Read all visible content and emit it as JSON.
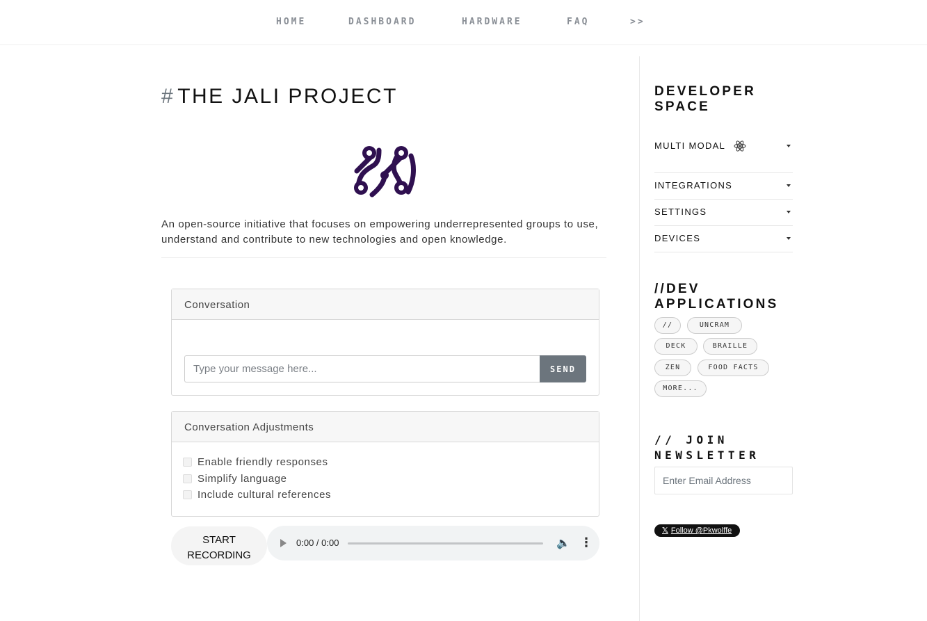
{
  "nav": {
    "items": [
      "HOME",
      "DASHBOARD",
      "HARDWARE",
      "FAQ",
      ">>"
    ]
  },
  "main": {
    "title_hash": "#",
    "title": "THE JALI PROJECT",
    "logo_icon": "circuit-logo-icon",
    "description": "An open-source initiative that focuses on empowering underrepresented groups to use, understand and contribute to new technologies and open knowledge.",
    "conversation": {
      "header": "Conversation",
      "input_placeholder": "Type your message here...",
      "input_value": "",
      "send_label": "SEND"
    },
    "adjustments": {
      "header": "Conversation Adjustments",
      "options": [
        {
          "label": "Enable friendly responses",
          "checked": false
        },
        {
          "label": "Simplify language",
          "checked": false
        },
        {
          "label": "Include cultural references",
          "checked": false
        }
      ]
    },
    "recorder": {
      "button_label_line1": "START",
      "button_label_line2": "RECORDING",
      "time": "0:00 / 0:00"
    }
  },
  "sidebar": {
    "developer_title": "DEVELOPER SPACE",
    "sections": [
      {
        "label": "MULTI MODAL",
        "icon": "react-atom-icon"
      },
      {
        "label": "INTEGRATIONS"
      },
      {
        "label": "SETTINGS"
      },
      {
        "label": "DEVICES"
      }
    ],
    "apps_title": "//DEV APPLICATIONS",
    "apps": [
      "//",
      "UNCRAM",
      "DECK",
      "BRAILLE",
      "ZEN",
      "FOOD FACTS",
      "MORE..."
    ],
    "newsletter_title": "// JOIN NEWSLETTER",
    "email_placeholder": "Enter Email Address",
    "follow_label": "Follow @Pkwolffe",
    "follow_icon": "x-logo-icon"
  },
  "colors": {
    "logo": "#2f1050",
    "send_button": "#6c757d",
    "nav_text": "#8a8f96"
  }
}
